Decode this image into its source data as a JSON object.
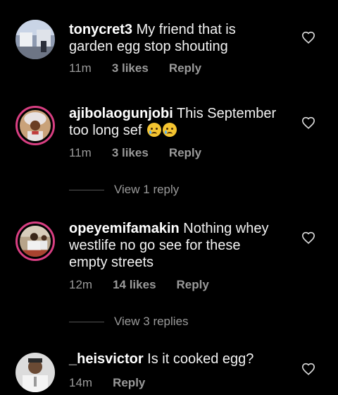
{
  "comments": [
    {
      "username": "tonycret3",
      "text": " My friend that is garden egg stop shouting",
      "time": "11m",
      "likes": "3 likes",
      "reply": "Reply"
    },
    {
      "username": "ajibolaogunjobi",
      "text": " This September too long sef ",
      "emoji": "crying-face-emoji x2",
      "time": "11m",
      "likes": "3 likes",
      "reply": "Reply",
      "view_replies": "View 1 reply"
    },
    {
      "username": "opeyemifamakin",
      "text": " Nothing whey westlife no go see for these empty streets",
      "time": "12m",
      "likes": "14 likes",
      "reply": "Reply",
      "view_replies": "View 3 replies"
    },
    {
      "username": "_heisvictor",
      "text": " Is it cooked egg?",
      "time": "14m",
      "reply": "Reply"
    }
  ],
  "colors": {
    "background": "#000000",
    "story_ring": "#d83f82",
    "meta_text": "#9a9a9a"
  }
}
